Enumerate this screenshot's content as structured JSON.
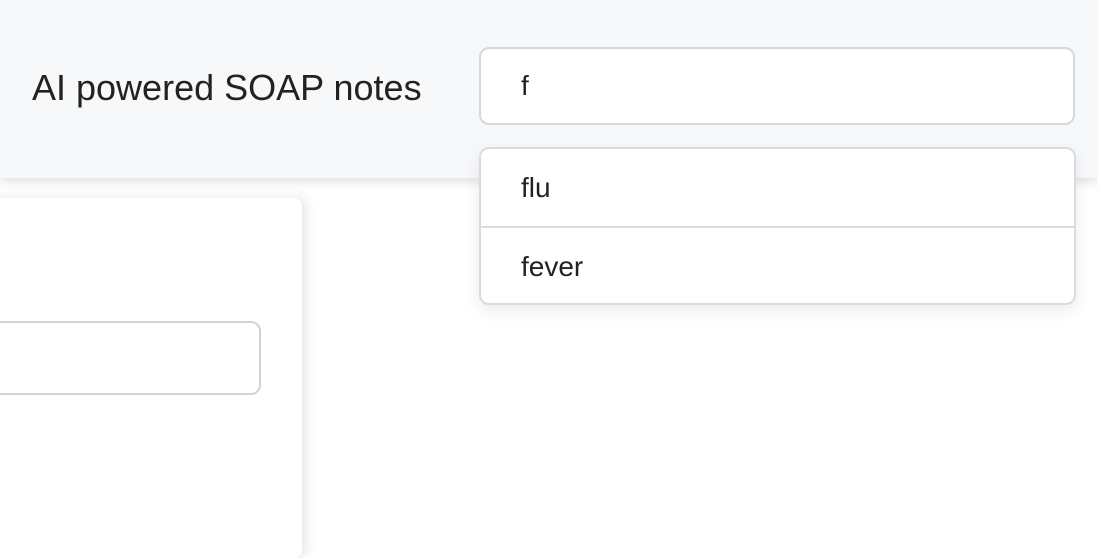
{
  "header": {
    "title": "AI powered SOAP notes"
  },
  "search": {
    "value": "f"
  },
  "suggestions": [
    "flu",
    "fever"
  ]
}
